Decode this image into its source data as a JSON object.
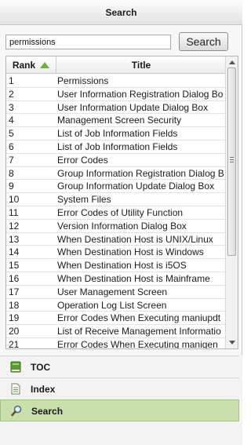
{
  "panel": {
    "title": "Search"
  },
  "search": {
    "query": "permissions",
    "button_label": "Search"
  },
  "table": {
    "columns": {
      "rank": "Rank",
      "title": "Title"
    },
    "rows": [
      {
        "rank": "1",
        "title": "Permissions"
      },
      {
        "rank": "2",
        "title": "User Information Registration Dialog Bo"
      },
      {
        "rank": "3",
        "title": "User Information Update Dialog Box"
      },
      {
        "rank": "4",
        "title": "Management Screen Security"
      },
      {
        "rank": "5",
        "title": "List of Job Information Fields"
      },
      {
        "rank": "6",
        "title": "List of Job Information Fields"
      },
      {
        "rank": "7",
        "title": "Error Codes"
      },
      {
        "rank": "8",
        "title": "Group Information Registration Dialog B"
      },
      {
        "rank": "9",
        "title": "Group Information Update Dialog Box"
      },
      {
        "rank": "10",
        "title": "System Files"
      },
      {
        "rank": "11",
        "title": "Error Codes of Utility Function"
      },
      {
        "rank": "12",
        "title": "Version Information Dialog Box"
      },
      {
        "rank": "13",
        "title": "When Destination Host is UNIX/Linux"
      },
      {
        "rank": "14",
        "title": "When Destination Host is Windows"
      },
      {
        "rank": "15",
        "title": "When Destination Host is i5OS"
      },
      {
        "rank": "16",
        "title": "When Destination Host is Mainframe"
      },
      {
        "rank": "17",
        "title": "User Management Screen"
      },
      {
        "rank": "18",
        "title": "Operation Log List Screen"
      },
      {
        "rank": "19",
        "title": "Error Codes When Executing maniupdt"
      },
      {
        "rank": "20",
        "title": "List of Receive Management Informatio"
      },
      {
        "rank": "21",
        "title": "Error Codes When Executing manigen"
      }
    ]
  },
  "nav": {
    "items": [
      {
        "label": "TOC",
        "icon": "book-icon"
      },
      {
        "label": "Index",
        "icon": "document-icon"
      },
      {
        "label": "Search",
        "icon": "magnifier-icon",
        "active": true
      }
    ]
  },
  "colors": {
    "accent": "#c8dfac",
    "sort_arrow": "#6fae3a"
  }
}
